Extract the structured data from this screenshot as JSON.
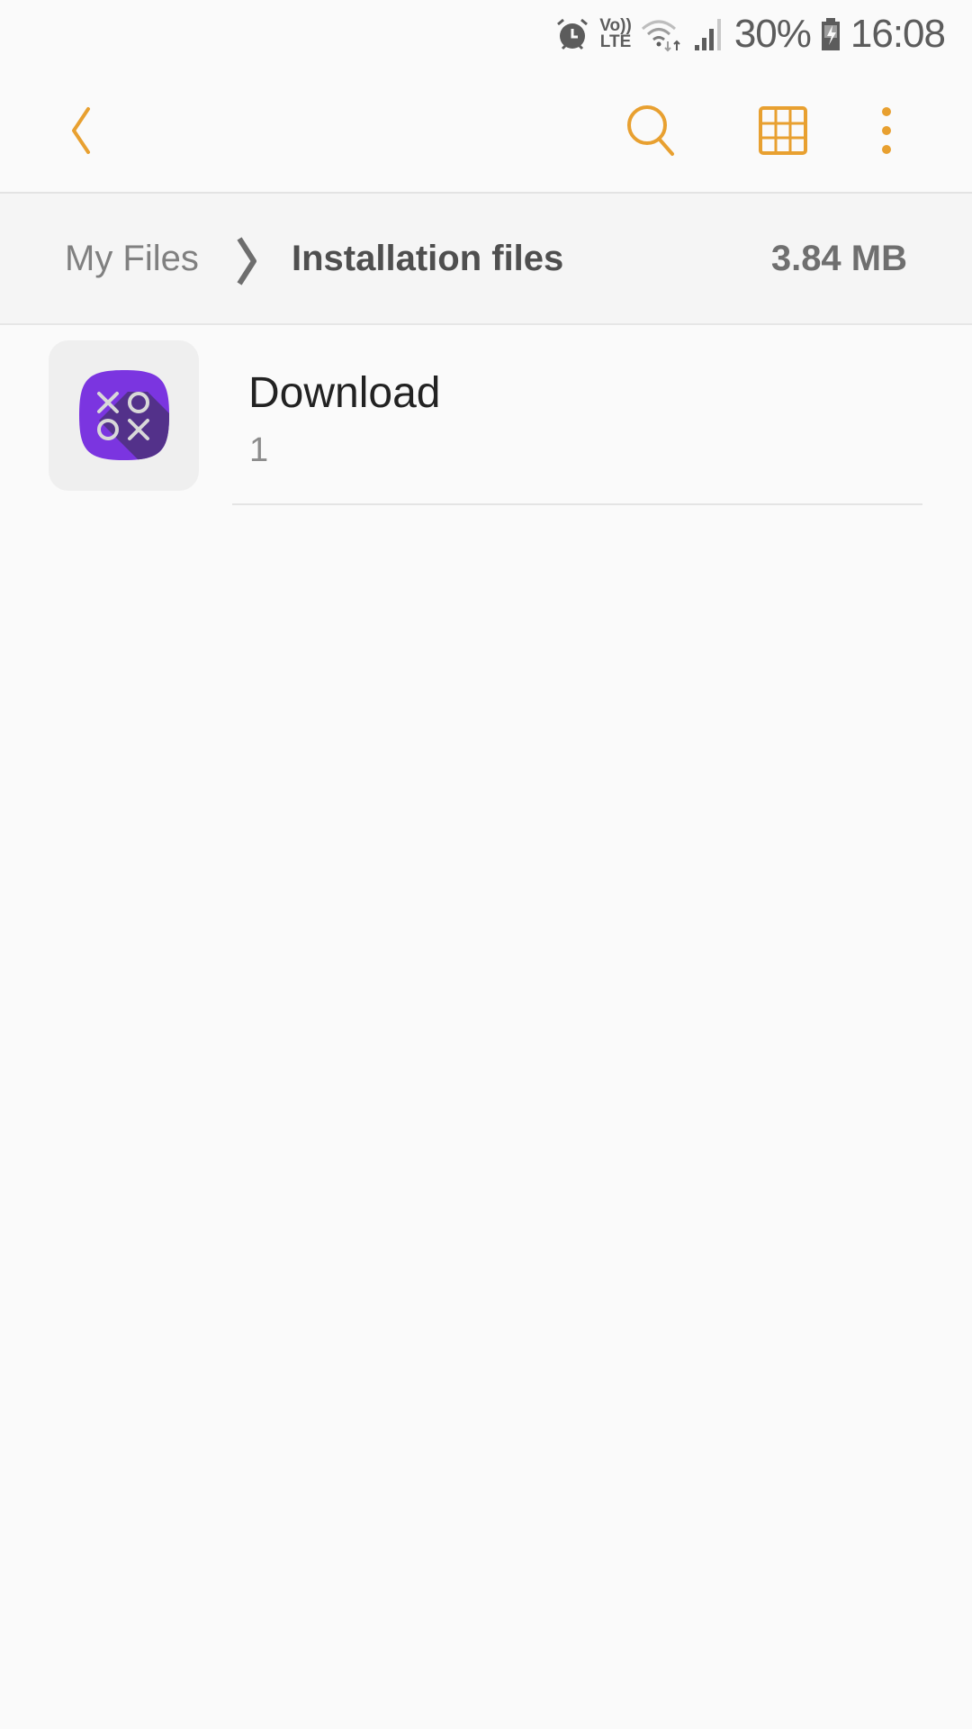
{
  "status_bar": {
    "alarm_icon": "alarm-icon",
    "volte_top": "Vo))",
    "volte_bottom": "LTE",
    "wifi_icon": "wifi-icon",
    "signal_icon": "signal-icon",
    "battery_percent": "30%",
    "battery_icon": "battery-charging-icon",
    "time": "16:08"
  },
  "app_bar": {
    "back_icon": "back-arrow-icon",
    "search_icon": "search-icon",
    "grid_icon": "grid-view-icon",
    "more_icon": "more-vert-icon",
    "accent_color": "#e8a030"
  },
  "breadcrumb": {
    "root": "My Files",
    "current": "Installation files",
    "size": "3.84 MB"
  },
  "items": [
    {
      "name": "Download",
      "count": "1",
      "icon": "tic-tac-toe-app-icon",
      "icon_color": "#7b35e0"
    }
  ]
}
